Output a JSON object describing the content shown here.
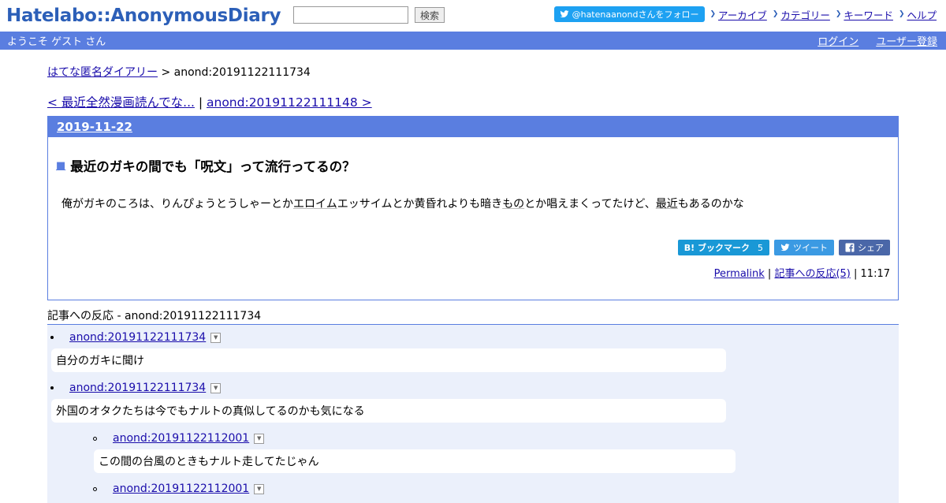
{
  "header": {
    "logo_text": "Hatelabo::AnonymousDiary",
    "search_placeholder": "",
    "search_button": "検索",
    "twitter_follow": "@hatenaanondさんをフォロー",
    "nav": [
      "アーカイブ",
      "カテゴリー",
      "キーワード",
      "ヘルプ"
    ]
  },
  "subbar": {
    "welcome": "ようこそ ゲスト さん",
    "login": "ログイン",
    "register": "ユーザー登録"
  },
  "breadcrumb": {
    "home": "はてな匿名ダイアリー",
    "current": " > anond:20191122111734"
  },
  "prevnext": {
    "prev": "< 最近全然漫画読んでな...",
    "sep": " | ",
    "next": "anond:20191122111148 >"
  },
  "entry": {
    "date": "2019-11-22",
    "title_mark": "■",
    "title": "最近のガキの間でも「呪文」って流行ってるの？",
    "body_parts": [
      "俺がガキのころは、りんぴょうとうしゃーとか",
      "エロイム",
      "エッサイムとか黄昏れよりも暗き",
      "もの",
      "とか唱えまくってたけど、",
      "最近",
      "もあるのかな"
    ],
    "share": {
      "hatena_label": "B! ブックマーク",
      "hatena_count": "5",
      "tweet_label": "ツイート",
      "fb_label": "シェア"
    },
    "footer": {
      "permalink": "Permalink",
      "sep1": " | ",
      "reactions": "記事への反応(5)",
      "sep2": " | ",
      "time": "11:17"
    }
  },
  "reactions": {
    "heading": "記事への反応 - anond:20191122111734",
    "items": [
      {
        "id": "anond:20191122111734",
        "text": "自分のガキに聞け"
      },
      {
        "id": "anond:20191122111734",
        "text": "外国のオタクたちは今でもナルトの真似してるのかも気になる"
      },
      {
        "id": "anond:20191122112001",
        "text": "この間の台風のときもナルト走してたじゃん"
      },
      {
        "id": "anond:20191122112001",
        "text": ""
      }
    ]
  },
  "colors": {
    "brand_blue": "#5a7ee0",
    "link": "#1a0dab",
    "reaction_bg": "#ebf0fb"
  }
}
